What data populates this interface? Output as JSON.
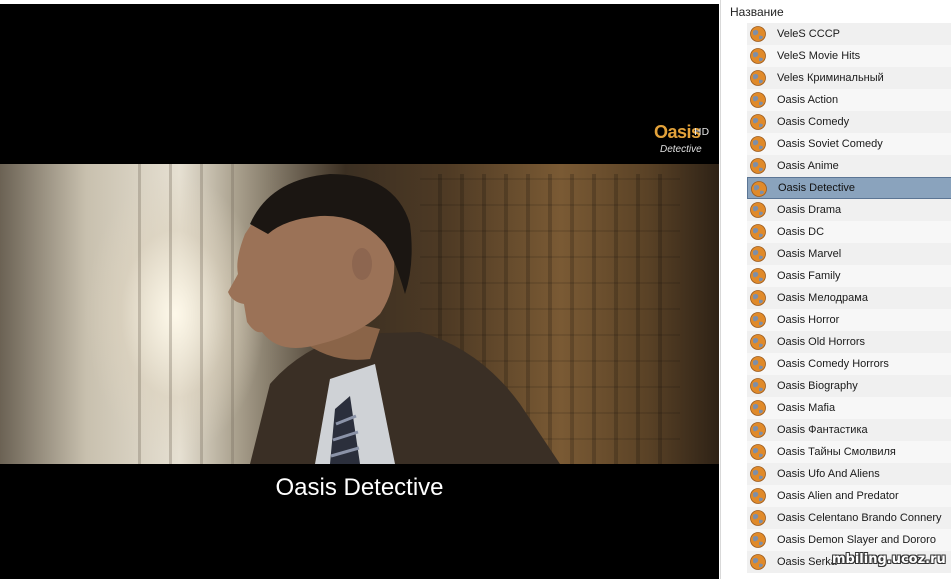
{
  "player": {
    "logo_brand": "Oasis",
    "logo_hd": "HD",
    "logo_sub": "Detective",
    "caption": "Oasis Detective"
  },
  "list": {
    "header": "Название",
    "items": [
      {
        "label": "VeleS СССР"
      },
      {
        "label": "VeleS Movie Hits"
      },
      {
        "label": "Veles Криминальный"
      },
      {
        "label": "Oasis Action"
      },
      {
        "label": "Oasis Comedy"
      },
      {
        "label": "Oasis Soviet Comedy"
      },
      {
        "label": "Oasis Anime"
      },
      {
        "label": "Oasis Detective",
        "selected": true
      },
      {
        "label": "Oasis Drama"
      },
      {
        "label": "Oasis DC"
      },
      {
        "label": "Oasis Marvel"
      },
      {
        "label": "Oasis Family"
      },
      {
        "label": "Oasis Мелодрама"
      },
      {
        "label": "Oasis Horror"
      },
      {
        "label": "Oasis Old Horrors"
      },
      {
        "label": "Oasis Comedy Horrors"
      },
      {
        "label": "Oasis Biography"
      },
      {
        "label": "Oasis Mafia"
      },
      {
        "label": "Oasis Фантастика"
      },
      {
        "label": "Oasis Тайны Смолвиля"
      },
      {
        "label": "Oasis Ufo And Aliens"
      },
      {
        "label": "Oasis Alien and Predator"
      },
      {
        "label": "Oasis Celentano Brando Connery"
      },
      {
        "label": "Oasis Demon Slayer and Dororo"
      },
      {
        "label": "Oasis Serka"
      }
    ]
  },
  "watermark": "mbiling.ucoz.ru",
  "colors": {
    "selected_row": "#8aa3bd",
    "row_bg": "#f0f0f0",
    "logo_accent": "#e3a23a"
  },
  "icon": "globe-icon"
}
